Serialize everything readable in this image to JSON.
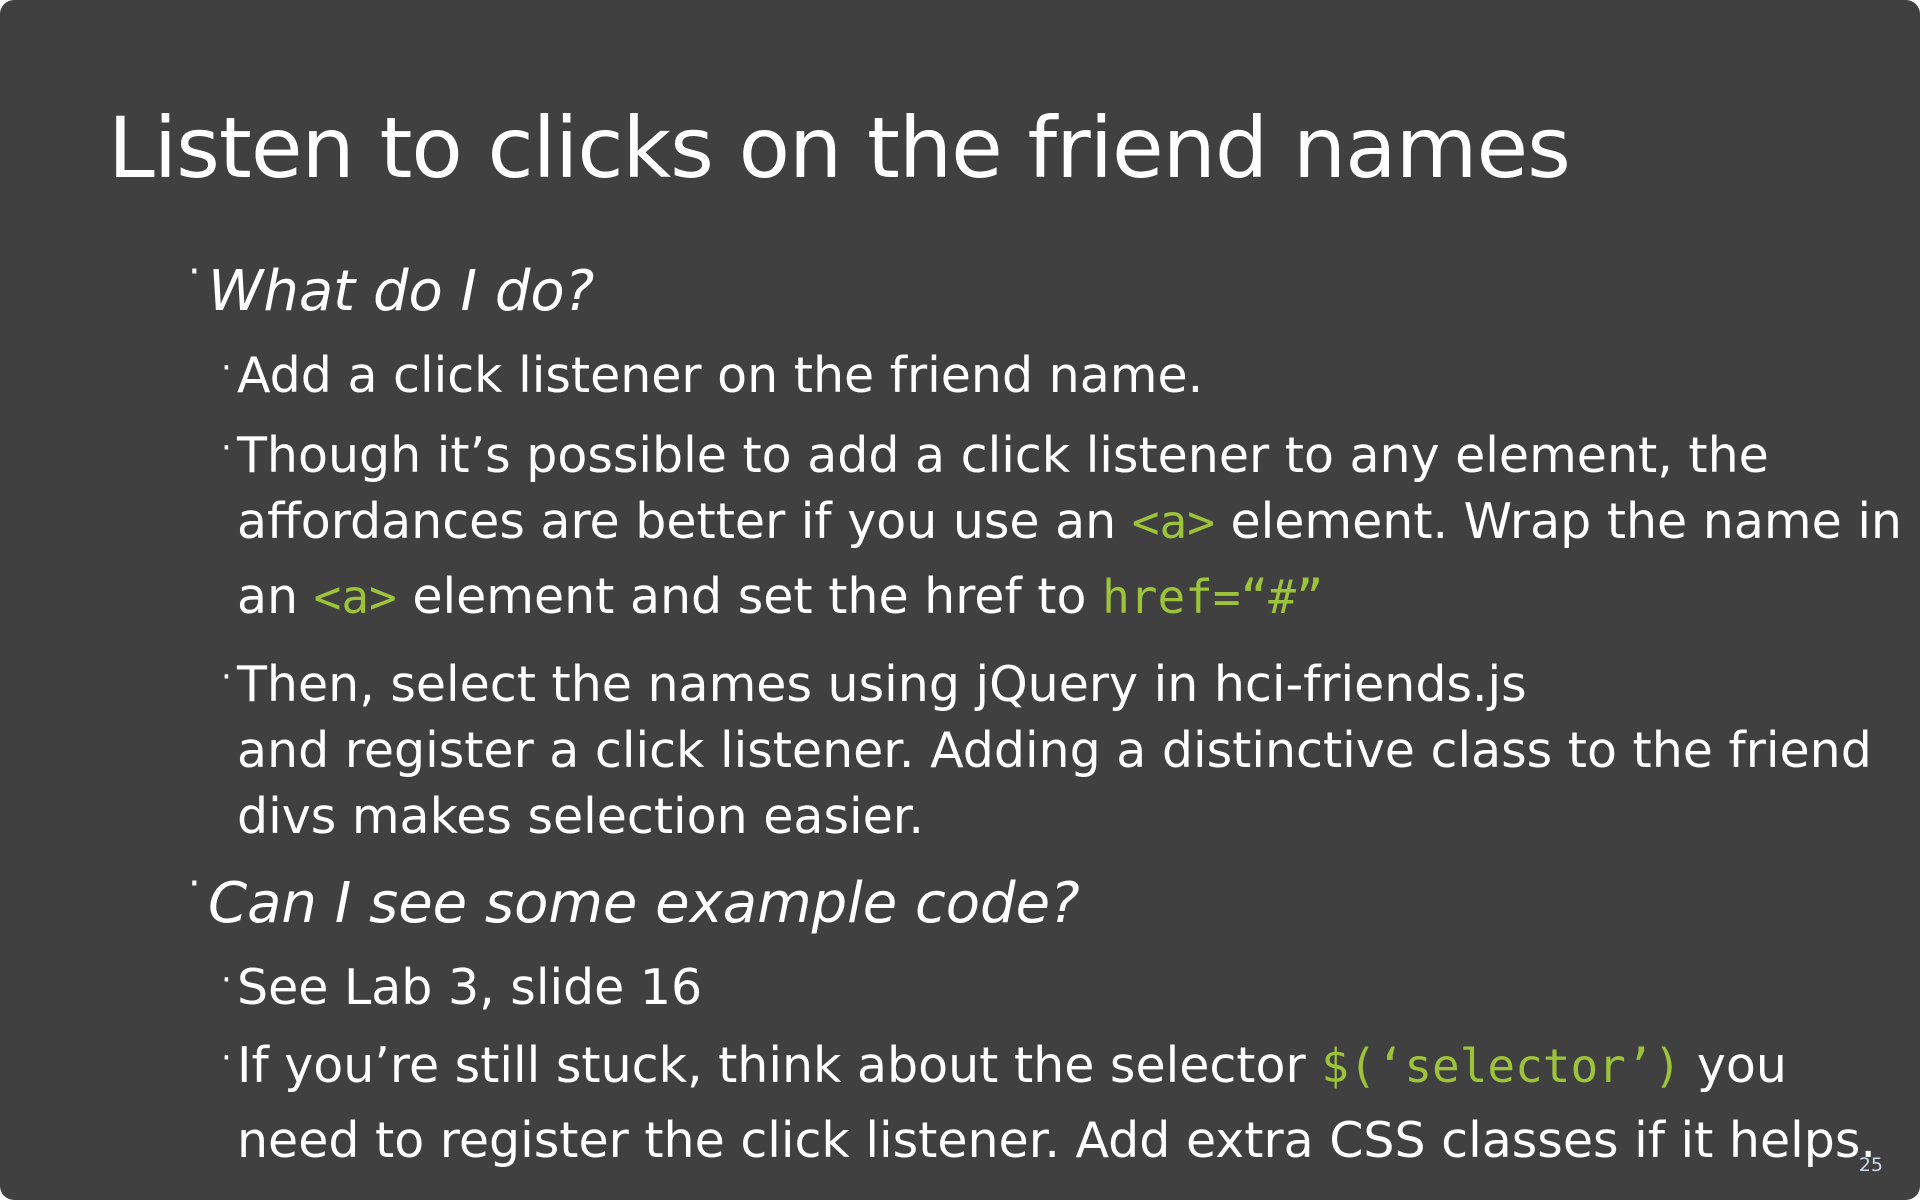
{
  "slide": {
    "title": "Listen to clicks on the friend names",
    "page_number": "25",
    "bullet_glyph": "·",
    "q1": {
      "text": "What do I do?",
      "items": {
        "i1": "Add a click listener on the friend name.",
        "i2": {
          "line1": "Though it’s possible to add a click listener to any element, the",
          "line2_pre": "affordances are better if you use an ",
          "line2_code": "<a>",
          "line2_post": " element. Wrap the name in",
          "line3_pre": "an ",
          "line3_code1": "<a>",
          "line3_mid": " element and set the href to ",
          "line3_code2": "href=“#”"
        },
        "i3": {
          "line1": "Then, select the names using jQuery in hci-friends.js",
          "line2": "and register a click listener. Adding a distinctive class to the friend",
          "line3": "divs makes selection easier."
        }
      }
    },
    "q2": {
      "text": "Can I see some example code?",
      "items": {
        "i1": "See Lab 3, slide 16",
        "i2": {
          "line1_pre": "If you’re still stuck, think about the selector ",
          "line1_code": "$(‘selector’)",
          "line1_post": " you",
          "line2": "need to register the click listener. Add extra CSS classes if it helps."
        }
      }
    },
    "colors": {
      "background": "#404040",
      "text": "#ffffff",
      "code": "#9dc33a",
      "page_number": "#cfd8ec"
    }
  }
}
